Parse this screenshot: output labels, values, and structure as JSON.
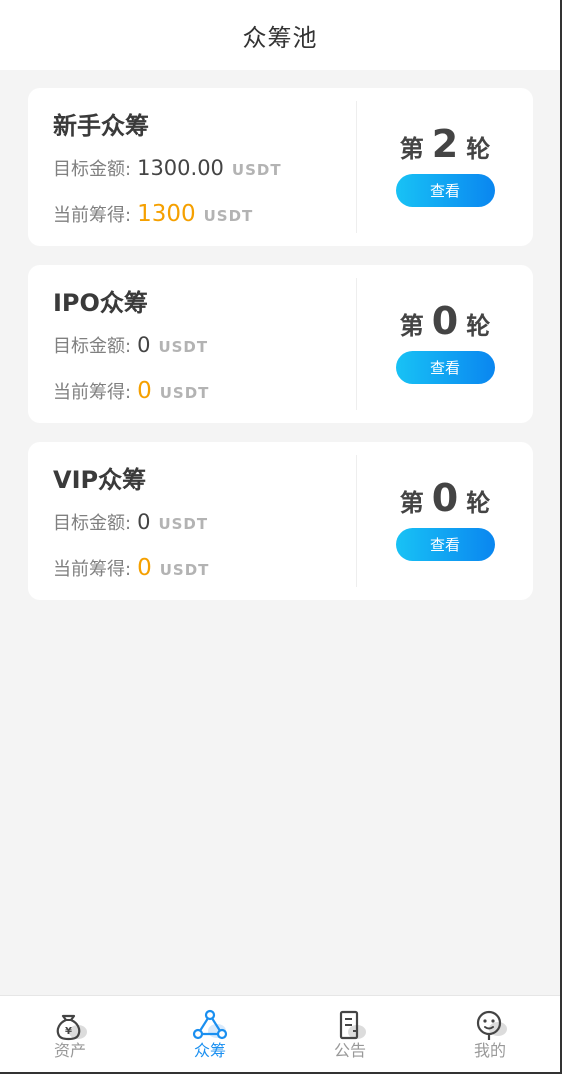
{
  "header": {
    "title": "众筹池"
  },
  "cards": [
    {
      "title": "新手众筹",
      "target_label": "目标金额:",
      "target_value": "1300.00",
      "target_unit": "USDT",
      "current_label": "当前筹得:",
      "current_value": "1300",
      "current_unit": "USDT",
      "round_prefix": "第",
      "round_number": "2",
      "round_suffix": "轮",
      "view_label": "查看"
    },
    {
      "title": "IPO众筹",
      "target_label": "目标金额:",
      "target_value": "0",
      "target_unit": "USDT",
      "current_label": "当前筹得:",
      "current_value": "0",
      "current_unit": "USDT",
      "round_prefix": "第",
      "round_number": "0",
      "round_suffix": "轮",
      "view_label": "查看"
    },
    {
      "title": "VIP众筹",
      "target_label": "目标金额:",
      "target_value": "0",
      "target_unit": "USDT",
      "current_label": "当前筹得:",
      "current_value": "0",
      "current_unit": "USDT",
      "round_prefix": "第",
      "round_number": "0",
      "round_suffix": "轮",
      "view_label": "查看"
    }
  ],
  "tabbar": {
    "items": [
      {
        "label": "资产",
        "icon": "money-bag-icon",
        "active": false
      },
      {
        "label": "众筹",
        "icon": "crowdfund-network-icon",
        "active": true
      },
      {
        "label": "公告",
        "icon": "announcement-document-icon",
        "active": false
      },
      {
        "label": "我的",
        "icon": "user-profile-icon",
        "active": false
      }
    ]
  },
  "colors": {
    "accent_blue": "#1a8ff0",
    "amount_orange": "#f5a000",
    "button_gradient_start": "#18c2f5",
    "button_gradient_end": "#0a86f0",
    "background": "#f4f4f4"
  }
}
